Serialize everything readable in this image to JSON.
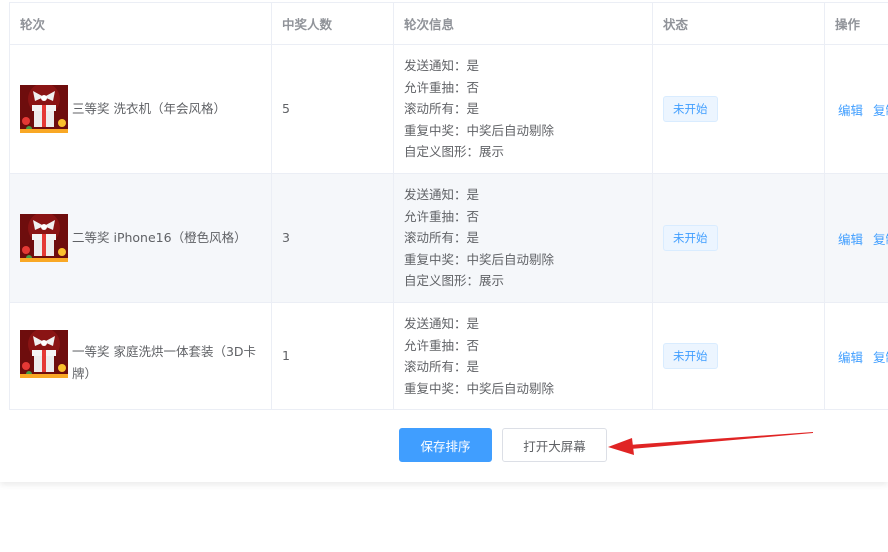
{
  "table": {
    "headers": {
      "round": "轮次",
      "winners": "中奖人数",
      "info": "轮次信息",
      "status": "状态",
      "actions": "操作"
    },
    "rows": [
      {
        "name": "三等奖 洗衣机（年会风格）",
        "winners": "5",
        "info": [
          "发送通知：是",
          "允许重抽：否",
          "滚动所有：是",
          "重复中奖：中奖后自动剔除",
          "自定义图形：展示"
        ],
        "status": "未开始",
        "edit": "编辑",
        "copy": "复制"
      },
      {
        "name": "二等奖 iPhone16（橙色风格）",
        "winners": "3",
        "info": [
          "发送通知：是",
          "允许重抽：否",
          "滚动所有：是",
          "重复中奖：中奖后自动剔除",
          "自定义图形：展示"
        ],
        "status": "未开始",
        "edit": "编辑",
        "copy": "复制"
      },
      {
        "name": "一等奖 家庭洗烘一体套装（3D卡牌）",
        "winners": "1",
        "info": [
          "发送通知：是",
          "允许重抽：否",
          "滚动所有：是",
          "重复中奖：中奖后自动剔除"
        ],
        "status": "未开始",
        "edit": "编辑",
        "copy": "复制"
      }
    ]
  },
  "footer": {
    "save_label": "保存排序",
    "open_label": "打开大屏幕"
  },
  "colors": {
    "primary": "#409eff",
    "annotation_arrow": "#e02424"
  },
  "icons": {
    "prize": "gift-box-icon"
  }
}
